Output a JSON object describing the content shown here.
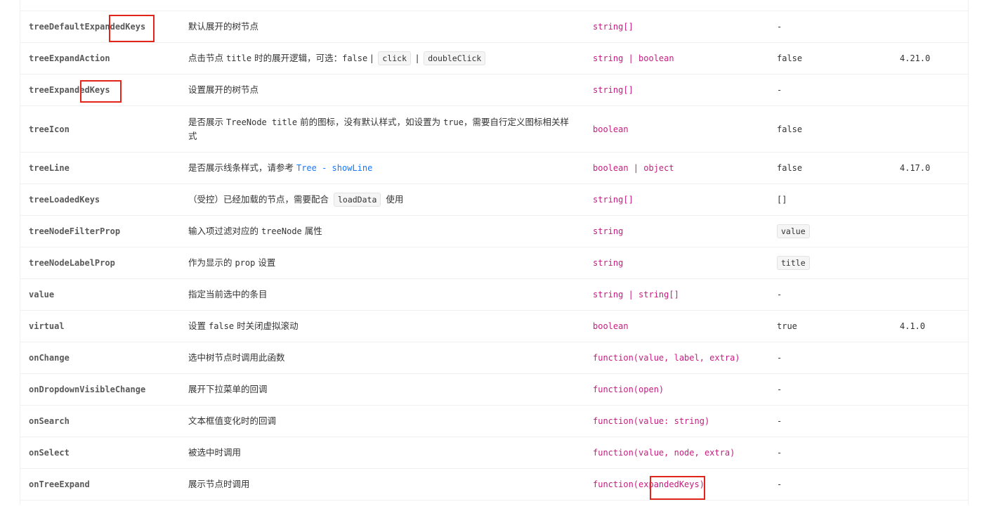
{
  "rows": [
    {
      "prop": "treeDefaultExpandedKeys",
      "desc": "默认展开的树节点",
      "type": "string[]",
      "default": "-",
      "version": ""
    },
    {
      "prop": "treeExpandAction",
      "desc_parts": [
        "点击节点 ",
        "title",
        " 时的展开逻辑，可选：",
        "false",
        " | ",
        "click",
        " | ",
        "doubleClick"
      ],
      "type": "string | boolean",
      "default": "false",
      "version": "4.21.0"
    },
    {
      "prop": "treeExpandedKeys",
      "desc": "设置展开的树节点",
      "type": "string[]",
      "default": "-",
      "version": ""
    },
    {
      "prop": "treeIcon",
      "desc_parts": [
        "是否展示 ",
        "TreeNode title",
        " 前的图标，没有默认样式，如设置为 ",
        "true",
        "，需要自行定义图标相关样式"
      ],
      "type": "boolean",
      "default": "false",
      "version": ""
    },
    {
      "prop": "treeLine",
      "desc_parts": [
        "是否展示线条样式，请参考 ",
        "Tree - showLine"
      ],
      "type": "boolean | object",
      "default": "false",
      "version": "4.17.0"
    },
    {
      "prop": "treeLoadedKeys",
      "desc_parts": [
        "（受控）已经加载的节点，需要配合 ",
        "loadData",
        " 使用"
      ],
      "type": "string[]",
      "default": "[]",
      "version": ""
    },
    {
      "prop": "treeNodeFilterProp",
      "desc_parts": [
        "输入项过滤对应的 ",
        "treeNode",
        " 属性"
      ],
      "type": "string",
      "default": "value",
      "version": ""
    },
    {
      "prop": "treeNodeLabelProp",
      "desc_parts": [
        "作为显示的 ",
        "prop",
        " 设置"
      ],
      "type": "string",
      "default": "title",
      "version": ""
    },
    {
      "prop": "value",
      "desc": "指定当前选中的条目",
      "type": "string | string[]",
      "default": "-",
      "version": ""
    },
    {
      "prop": "virtual",
      "desc_parts": [
        "设置 ",
        "false",
        " 时关闭虚拟滚动"
      ],
      "type": "boolean",
      "default": "true",
      "version": "4.1.0"
    },
    {
      "prop": "onChange",
      "desc": "选中树节点时调用此函数",
      "type": "function(value, label, extra)",
      "default": "-",
      "version": ""
    },
    {
      "prop": "onDropdownVisibleChange",
      "desc": "展开下拉菜单的回调",
      "type": "function(open)",
      "default": "-",
      "version": ""
    },
    {
      "prop": "onSearch",
      "desc": "文本框值变化时的回调",
      "type": "function(value: string)",
      "default": "-",
      "version": ""
    },
    {
      "prop": "onSelect",
      "desc": "被选中时调用",
      "type": "function(value, node, extra)",
      "default": "-",
      "version": ""
    },
    {
      "prop": "onTreeExpand",
      "desc": "展示节点时调用",
      "type": "function(expandedKeys)",
      "default": "-",
      "version": ""
    }
  ],
  "colors": {
    "type_text": "#c41d7f",
    "link": "#1677ff",
    "highlight_box": "#e3241b",
    "row_border": "#f0f0f0"
  }
}
